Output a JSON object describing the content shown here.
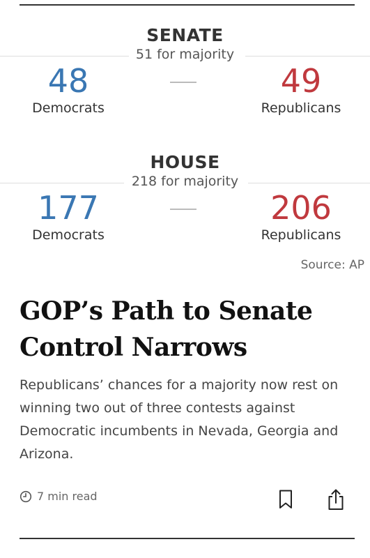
{
  "senate": {
    "title": "SENATE",
    "majority": "51 for majority",
    "dem_count": "48",
    "dem_label": "Democrats",
    "rep_count": "49",
    "rep_label": "Republicans"
  },
  "house": {
    "title": "HOUSE",
    "majority": "218 for majority",
    "dem_count": "177",
    "dem_label": "Democrats",
    "rep_count": "206",
    "rep_label": "Republicans"
  },
  "source": "Source: AP",
  "article": {
    "headline": "GOP’s Path to Senate Control Narrows",
    "summary": "Republicans’ chances for a majority now rest on winning two out of three contests against Democratic incumbents in Nevada, Georgia and Arizona.",
    "read_time": "7 min read"
  },
  "icons": {
    "clock": "clock-icon",
    "bookmark": "bookmark-icon",
    "share": "share-icon"
  },
  "colors": {
    "democrat": "#3a77b3",
    "republican": "#c0393e"
  }
}
